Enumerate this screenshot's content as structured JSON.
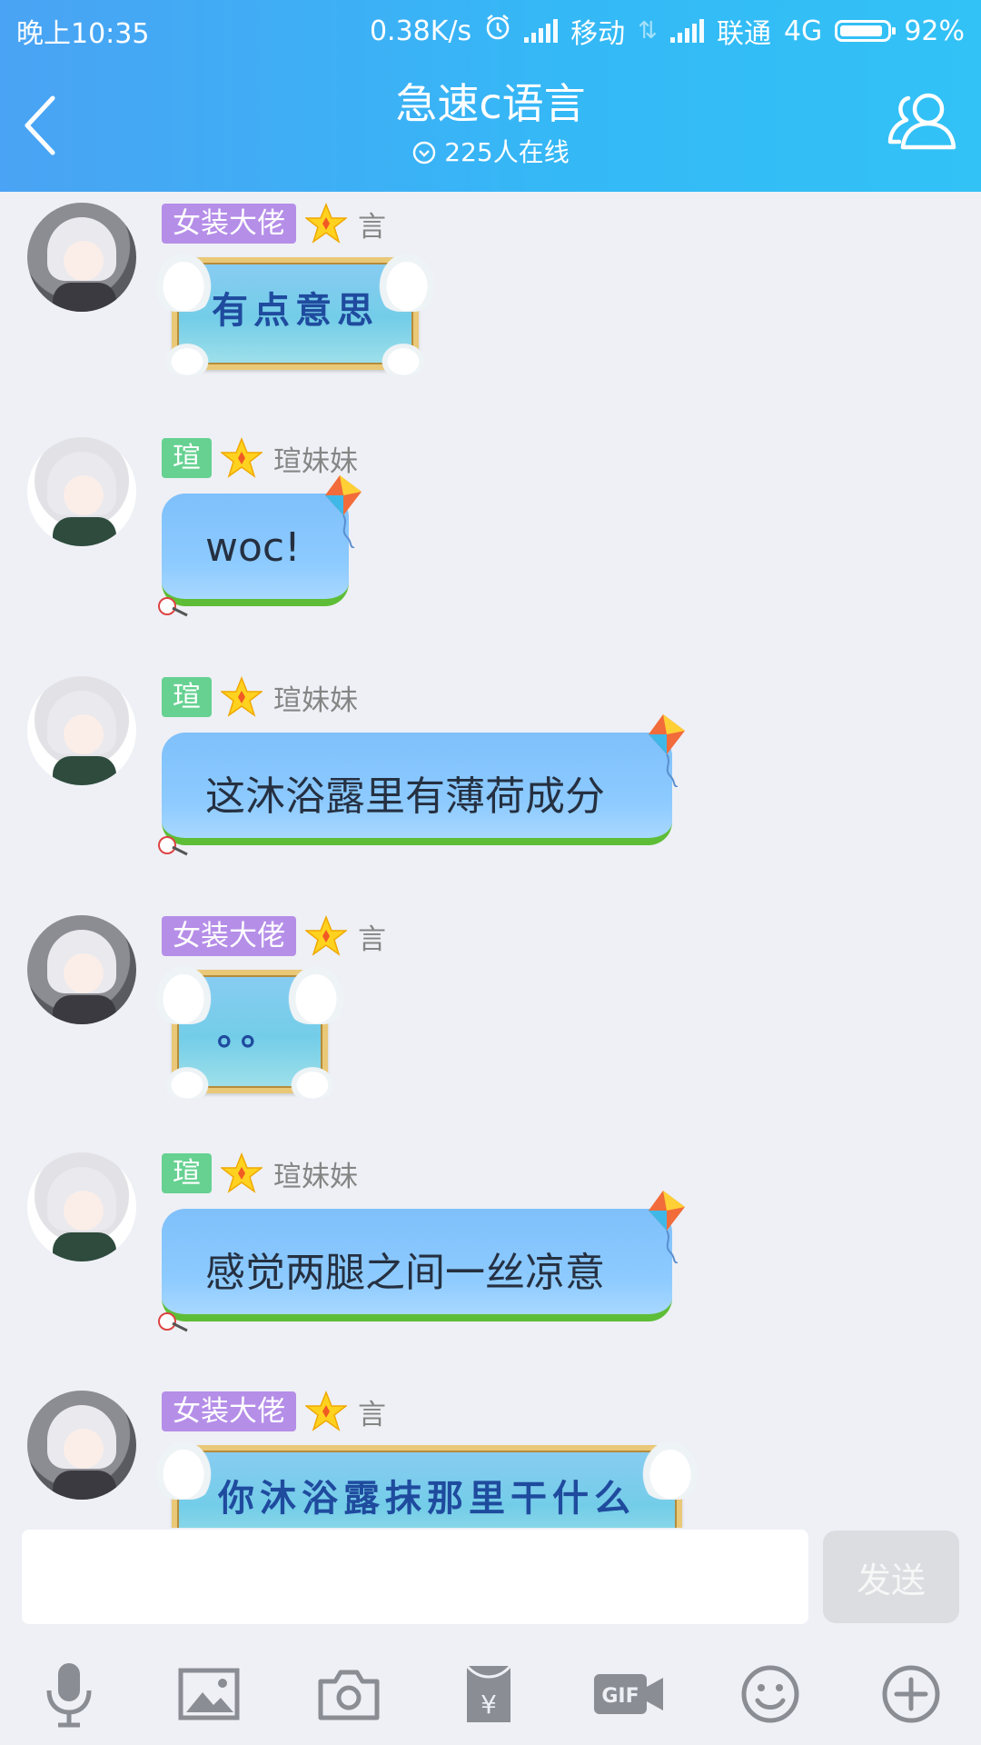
{
  "status_bar": {
    "time": "晚上10:35",
    "net_speed": "0.38K/s",
    "carrier1": "移动",
    "carrier2": "联通",
    "network": "4G",
    "battery_pct": "92%",
    "battery_level": 0.92
  },
  "header": {
    "title": "急速c语言",
    "online": "225人在线"
  },
  "messages": [
    {
      "badge": "女装大佬",
      "badge_color": "#b58ee8",
      "sender": "言",
      "text": "有点意思",
      "style": "winged",
      "avatar": "dark"
    },
    {
      "badge": "瑄",
      "badge_color": "#66d191",
      "sender": "瑄妹妹",
      "text": "woc!",
      "style": "kite",
      "avatar": "light"
    },
    {
      "badge": "瑄",
      "badge_color": "#66d191",
      "sender": "瑄妹妹",
      "text": "这沐浴露里有薄荷成分",
      "style": "kite",
      "avatar": "light"
    },
    {
      "badge": "女装大佬",
      "badge_color": "#b58ee8",
      "sender": "言",
      "text": "。。",
      "style": "winged",
      "avatar": "dark"
    },
    {
      "badge": "瑄",
      "badge_color": "#66d191",
      "sender": "瑄妹妹",
      "text": "感觉两腿之间一丝凉意",
      "style": "kite",
      "avatar": "light"
    },
    {
      "badge": "女装大佬",
      "badge_color": "#b58ee8",
      "sender": "言",
      "text": "你沐浴露抹那里干什么",
      "style": "winged",
      "avatar": "dark"
    }
  ],
  "input": {
    "value": "",
    "send_label": "发送"
  },
  "toolbar": {
    "icons": [
      "microphone-icon",
      "image-icon",
      "camera-icon",
      "red-packet-icon",
      "gif-icon",
      "emoji-icon",
      "plus-icon"
    ]
  },
  "colors": {
    "header_gradient_start": "#4aa3f4",
    "header_gradient_end": "#32c2f6",
    "background": "#eef0f5",
    "badge_purple": "#b58ee8",
    "badge_green": "#66d191",
    "bubble_blue": "#8ccaff",
    "bubble_grass": "#5ebd37"
  }
}
